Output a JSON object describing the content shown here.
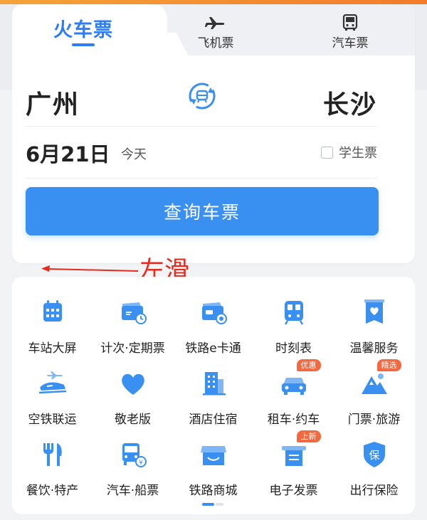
{
  "tabs": {
    "train": "火车票",
    "flight": "飞机票",
    "bus": "汽车票"
  },
  "route": {
    "from": "广州",
    "to": "长沙"
  },
  "date": {
    "value": "6月21日",
    "relative": "今天"
  },
  "student_ticket": {
    "label": "学生票",
    "checked": false
  },
  "search_button": "查询车票",
  "annotation": {
    "text": "左滑",
    "color": "#e52a1e"
  },
  "services": [
    {
      "label": "车站大屏",
      "icon": "calendar-icon",
      "badge": ""
    },
    {
      "label": "计次·定期票",
      "icon": "ticket-clock-icon",
      "badge": ""
    },
    {
      "label": "铁路e卡通",
      "icon": "rail-card-icon",
      "badge": ""
    },
    {
      "label": "时刻表",
      "icon": "train-front-icon",
      "badge": ""
    },
    {
      "label": "温馨服务",
      "icon": "heart-card-icon",
      "badge": ""
    },
    {
      "label": "空铁联运",
      "icon": "plane-train-icon",
      "badge": ""
    },
    {
      "label": "敬老版",
      "icon": "heart-icon",
      "badge": ""
    },
    {
      "label": "酒店住宿",
      "icon": "hotel-icon",
      "badge": ""
    },
    {
      "label": "租车·约车",
      "icon": "car-icon",
      "badge": "优惠"
    },
    {
      "label": "门票·旅游",
      "icon": "mountain-icon",
      "badge": "精选"
    },
    {
      "label": "餐饮·特产",
      "icon": "fork-knife-icon",
      "badge": ""
    },
    {
      "label": "汽车·船票",
      "icon": "bus-ticket-icon",
      "badge": ""
    },
    {
      "label": "铁路商城",
      "icon": "shop-icon",
      "badge": ""
    },
    {
      "label": "电子发票",
      "icon": "invoice-icon",
      "badge": "上新"
    },
    {
      "label": "出行保险",
      "icon": "shield-icon",
      "badge": ""
    }
  ],
  "colors": {
    "accent": "#3a90f0",
    "badge": "#f4683f"
  },
  "pager": {
    "pages": 2,
    "current": 1
  }
}
